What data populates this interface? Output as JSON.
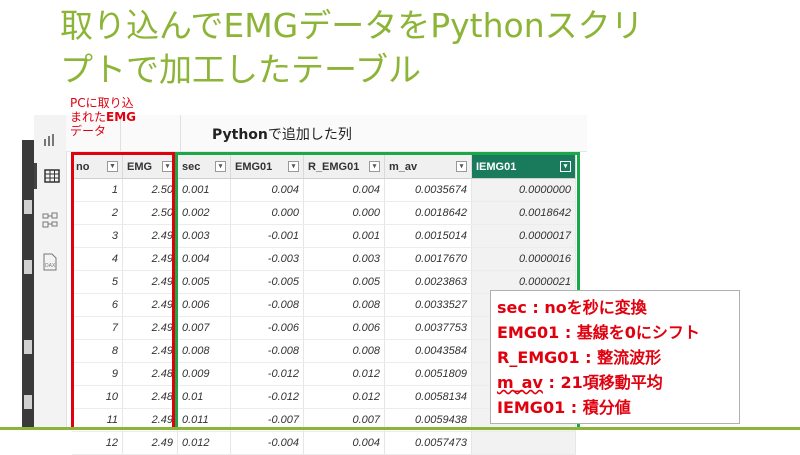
{
  "slide": {
    "title_line1": "取り込んでEMGデータをPythonスクリ",
    "title_line2": "プトで加工したテーブル",
    "accent_color": "#8cb437"
  },
  "annotations": {
    "red_line1": "PCに取り込",
    "red_line2_prefix": "まれた",
    "red_line2_bold": "EMG",
    "red_line3": "データ",
    "python_bold": "Python",
    "python_rest": "で追加した列"
  },
  "table": {
    "columns": [
      "no",
      "EMG",
      "sec",
      "EMG01",
      "R_EMG01",
      "m_av",
      "IEMG01"
    ],
    "rows": [
      [
        "1",
        "2.50",
        "0.001",
        "0.004",
        "0.004",
        "0.0035674",
        "0.0000000"
      ],
      [
        "2",
        "2.50",
        "0.002",
        "0.000",
        "0.000",
        "0.0018642",
        "0.0018642"
      ],
      [
        "3",
        "2.49",
        "0.003",
        "-0.001",
        "0.001",
        "0.0015014",
        "0.0000017"
      ],
      [
        "4",
        "2.49",
        "0.004",
        "-0.003",
        "0.003",
        "0.0017670",
        "0.0000016"
      ],
      [
        "5",
        "2.49",
        "0.005",
        "-0.005",
        "0.005",
        "0.0023863",
        "0.0000021"
      ],
      [
        "6",
        "2.49",
        "0.006",
        "-0.008",
        "0.008",
        "0.0033527",
        ""
      ],
      [
        "7",
        "2.49",
        "0.007",
        "-0.006",
        "0.006",
        "0.0037753",
        ""
      ],
      [
        "8",
        "2.49",
        "0.008",
        "-0.008",
        "0.008",
        "0.0043584",
        ""
      ],
      [
        "9",
        "2.48",
        "0.009",
        "-0.012",
        "0.012",
        "0.0051809",
        ""
      ],
      [
        "10",
        "2.48",
        "0.01",
        "-0.012",
        "0.012",
        "0.0058134",
        ""
      ],
      [
        "11",
        "2.49",
        "0.011",
        "-0.007",
        "0.007",
        "0.0059438",
        ""
      ],
      [
        "12",
        "2.49",
        "0.012",
        "-0.004",
        "0.004",
        "0.0057473",
        ""
      ]
    ]
  },
  "legend": {
    "line1": "sec : noを秒に変換",
    "line2": "EMG01 : 基線を0にシフト",
    "line3": "R_EMG01 : 整流波形",
    "line4_term": "m_av",
    "line4_rest": " : 21項移動平均",
    "line5": "IEMG01 : 積分値"
  },
  "icons": [
    "report-view-icon",
    "table-view-icon",
    "model-view-icon",
    "dax-query-icon",
    "filter-icon",
    "dropdown-icon"
  ],
  "colors": {
    "red": "#e0000e",
    "green": "#1aa84a",
    "iemg_header": "#1a7a5c"
  }
}
